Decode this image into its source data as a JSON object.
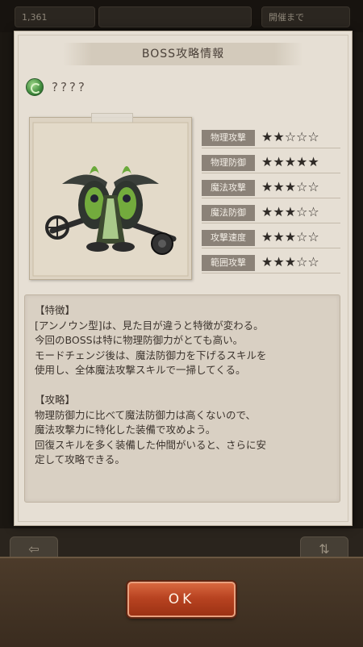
{
  "background": {
    "top_left_text": "1,361",
    "top_right_text": "開催まで"
  },
  "dialog": {
    "title": "BOSS攻略情報",
    "boss_name": "????",
    "stats": [
      {
        "label": "物理攻撃",
        "stars": "★★☆☆☆",
        "rating": 2,
        "max": 5
      },
      {
        "label": "物理防御",
        "stars": "★★★★★",
        "rating": 5,
        "max": 5
      },
      {
        "label": "魔法攻撃",
        "stars": "★★★☆☆",
        "rating": 3,
        "max": 5
      },
      {
        "label": "魔法防御",
        "stars": "★★★☆☆",
        "rating": 3,
        "max": 5
      },
      {
        "label": "攻撃速度",
        "stars": "★★★☆☆",
        "rating": 3,
        "max": 5
      },
      {
        "label": "範囲攻撃",
        "stars": "★★★☆☆",
        "rating": 3,
        "max": 5
      }
    ],
    "description": {
      "features_heading": "【特徴】",
      "features_lines": [
        "[アンノウン型]は、見た目が違うと特徴が変わる。",
        "今回のBOSSは特に物理防御力がとても高い。",
        "モードチェンジ後は、魔法防御力を下げるスキルを",
        "使用し、全体魔法攻撃スキルで一掃してくる。"
      ],
      "strategy_heading": "【攻略】",
      "strategy_lines": [
        "物理防御力に比べて魔法防御力は高くないので、",
        "魔法攻撃力に特化した装備で攻めよう。",
        "回復スキルを多く装備した仲間がいると、さらに安",
        "定して攻略できる。"
      ]
    },
    "ok_label": "OK"
  },
  "colors": {
    "panel": "#e6dfd4",
    "stat_label_bg": "#8b8278",
    "ok_button": "#b84321"
  }
}
